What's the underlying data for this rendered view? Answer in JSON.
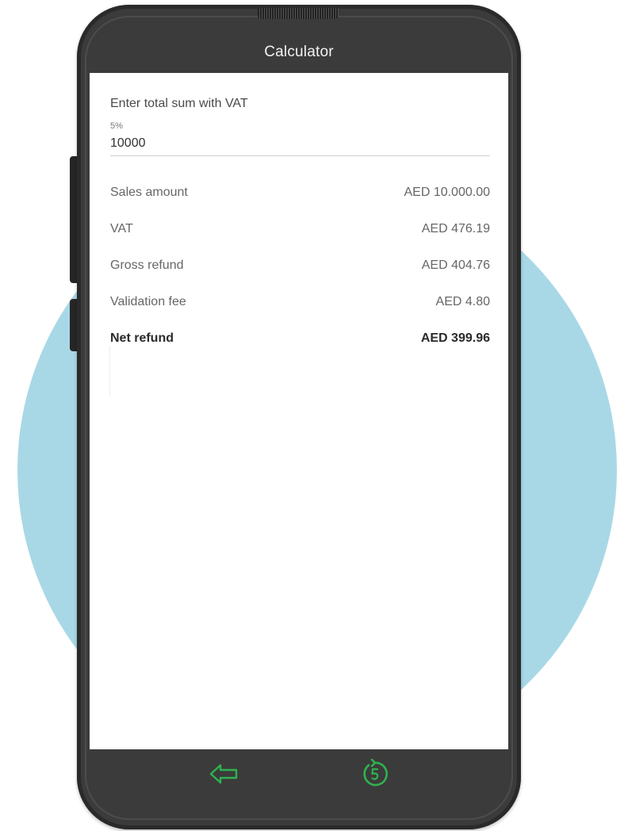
{
  "app": {
    "title": "Calculator"
  },
  "form": {
    "label": "Enter total sum with VAT",
    "vat_rate": "5%",
    "amount_value": "10000"
  },
  "results": [
    {
      "label": "Sales amount",
      "value": "AED 10.000.00"
    },
    {
      "label": "VAT",
      "value": "AED 476.19"
    },
    {
      "label": "Gross refund",
      "value": "AED 404.76"
    },
    {
      "label": "Validation fee",
      "value": "AED 4.80"
    },
    {
      "label": "Net refund",
      "value": "AED 399.96"
    }
  ],
  "bottom_nav": {
    "back_icon": "back-arrow-icon",
    "reset_icon": "reset-circle-icon"
  },
  "colors": {
    "accent_green": "#2fb24f",
    "background_circle": "#a8d8e6",
    "device_body": "#3b3b3b"
  }
}
